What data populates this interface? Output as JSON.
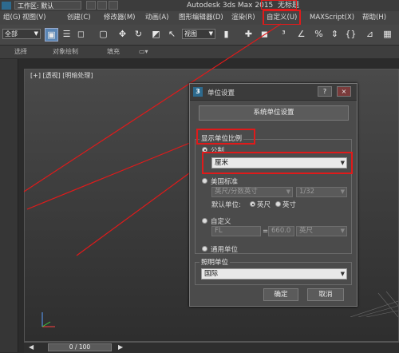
{
  "titlebar": {
    "workspace_label": "工作区: 默认",
    "app_title": "Autodesk 3ds Max  2015",
    "doc_title": "无标题"
  },
  "menubar": {
    "items": [
      "组(G)",
      "视图(V)",
      "创建(C)",
      "修改器(M)",
      "动画(A)",
      "图形编辑器(D)",
      "渲染(R)",
      "自定义(U)",
      "MAXScript(X)",
      "帮助(H)"
    ]
  },
  "toolbar": {
    "selection_filter": "全部",
    "coord_system": "视图",
    "icons": [
      "select-object-icon",
      "select-by-name-icon",
      "rectangular-selection-icon",
      "window-crossing-icon",
      "move-icon",
      "rotate-icon",
      "scale-icon",
      "pivot-icon",
      "snap-3d-icon",
      "angle-snap-icon",
      "percent-snap-icon",
      "spinner-snap-icon"
    ]
  },
  "ribbon": {
    "items": [
      "选择",
      "对象绘制",
      "填充"
    ]
  },
  "viewport": {
    "label": "[+] [透视] [明暗处理]"
  },
  "timeline": {
    "frame": "0 / 100"
  },
  "dialog": {
    "title": "单位设置",
    "help_btn": "?",
    "close_btn": "×",
    "system_units_btn": "系统单位设置",
    "display_scale_group": "显示单位比例",
    "metric_label": "公制",
    "metric_value": "厘米",
    "us_label": "美国标准",
    "us_value": "英尺/分数英寸",
    "us_fraction": "1/32",
    "default_units_label": "默认单位:",
    "feet_label": "英尺",
    "inches_label": "英寸",
    "custom_label": "自定义",
    "custom_name": "FL",
    "custom_eq": "=",
    "custom_value": "660.0",
    "custom_unit": "英尺",
    "generic_label": "通用单位",
    "lighting_group": "照明单位",
    "lighting_value": "国际",
    "ok_btn": "确定",
    "cancel_btn": "取消"
  },
  "colors": {
    "highlight": "#e01a1a",
    "dialog_bg": "#4b4b4b",
    "viewport_bg": "#3d3d3d"
  }
}
